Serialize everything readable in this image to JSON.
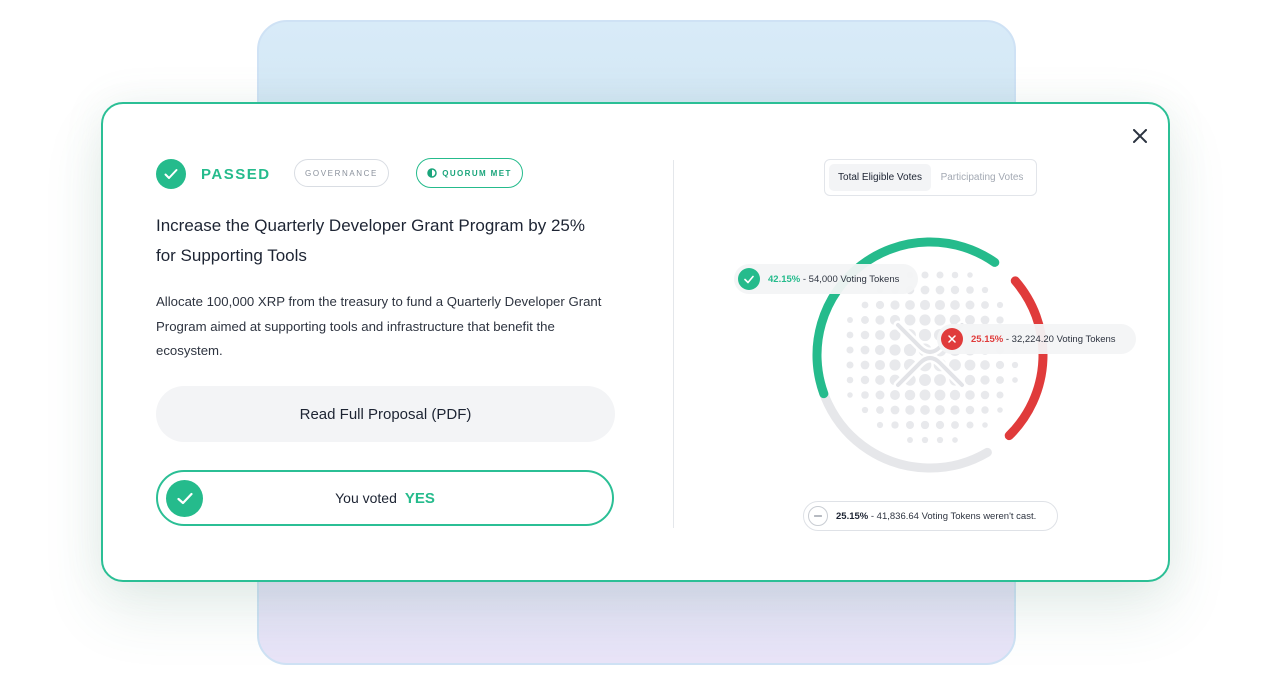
{
  "status": {
    "label": "PASSED",
    "tag": "GOVERNANCE",
    "quorum": "QUORUM MET"
  },
  "proposal": {
    "title": "Increase the Quarterly Developer Grant Program by 25% for Supporting Tools",
    "description": "Allocate 100,000 XRP from the treasury to fund a Quarterly Developer Grant Program aimed at supporting tools and infrastructure that benefit the ecosystem.",
    "read_button": "Read Full Proposal (PDF)"
  },
  "vote": {
    "prefix": "You voted",
    "choice": "YES"
  },
  "tabs": {
    "active": "Total Eligible Votes",
    "inactive": "Participating Votes"
  },
  "results": {
    "yes": {
      "pct": "42.15%",
      "text": " - 54,000 Voting Tokens",
      "value": 42.15
    },
    "no": {
      "pct": "25.15%",
      "text": " - 32,224.20 Voting Tokens",
      "value": 25.15
    },
    "none": {
      "pct": "25.15%",
      "text": " - 41,836.64 Voting Tokens weren't cast.",
      "value": 25.15
    }
  },
  "colors": {
    "accent": "#25bb8c",
    "danger": "#e03b3b",
    "neutral": "#e6e7ea"
  },
  "icons": {
    "close": "close-icon",
    "check": "check-icon",
    "x": "x-icon",
    "minus": "minus-icon",
    "quorum": "half-circle-icon",
    "logo": "xrp-logo-icon"
  }
}
